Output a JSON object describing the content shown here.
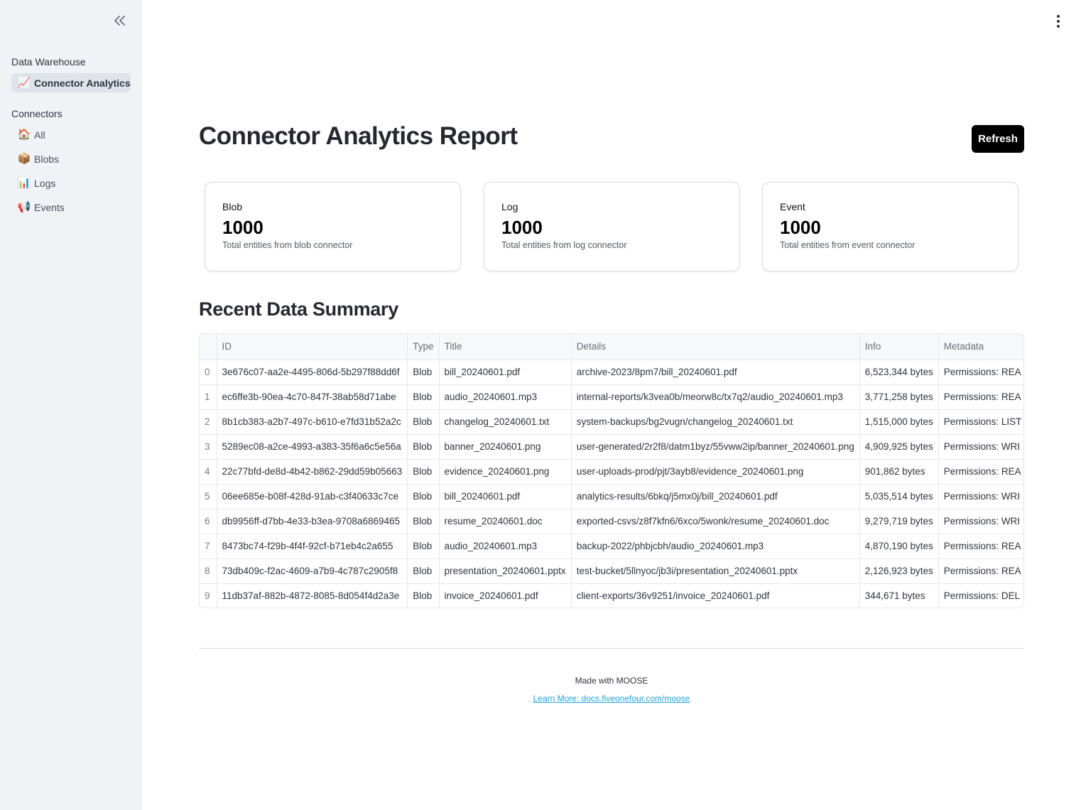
{
  "sidebar": {
    "collapse_icon": "double-chevron-left-icon",
    "section_warehouse": "Data Warehouse",
    "warehouse_items": [
      {
        "emoji": "📈",
        "label": "Connector Analytics",
        "active": true
      }
    ],
    "section_connectors": "Connectors",
    "connector_items": [
      {
        "emoji": "🏠",
        "label": "All"
      },
      {
        "emoji": "📦",
        "label": "Blobs"
      },
      {
        "emoji": "📊",
        "label": "Logs"
      },
      {
        "emoji": "📢",
        "label": "Events"
      }
    ]
  },
  "header": {
    "menu_icon": "kebab-menu-icon",
    "title": "Connector Analytics Report",
    "refresh_label": "Refresh"
  },
  "cards": [
    {
      "title": "Blob",
      "value": "1000",
      "desc": "Total entities from blob connector"
    },
    {
      "title": "Log",
      "value": "1000",
      "desc": "Total entities from log connector"
    },
    {
      "title": "Event",
      "value": "1000",
      "desc": "Total entities from event connector"
    }
  ],
  "summary": {
    "title": "Recent Data Summary",
    "columns": [
      "",
      "ID",
      "Type",
      "Title",
      "Details",
      "Info",
      "Metadata"
    ],
    "rows": [
      [
        "0",
        "3e676c07-aa2e-4495-806d-5b297f88dd6f",
        "Blob",
        "bill_20240601.pdf",
        "archive-2023/8pm7/bill_20240601.pdf",
        "6,523,344 bytes",
        "Permissions: REA"
      ],
      [
        "1",
        "ec6ffe3b-90ea-4c70-847f-38ab58d71abe",
        "Blob",
        "audio_20240601.mp3",
        "internal-reports/k3vea0b/meorw8c/tx7q2/audio_20240601.mp3",
        "3,771,258 bytes",
        "Permissions: REA"
      ],
      [
        "2",
        "8b1cb383-a2b7-497c-b610-e7fd31b52a2c",
        "Blob",
        "changelog_20240601.txt",
        "system-backups/bg2vugn/changelog_20240601.txt",
        "1,515,000 bytes",
        "Permissions: LIST"
      ],
      [
        "3",
        "5289ec08-a2ce-4993-a383-35f6a6c5e56a",
        "Blob",
        "banner_20240601.png",
        "user-generated/2r2f8/datm1byz/55vww2ip/banner_20240601.png",
        "4,909,925 bytes",
        "Permissions: WRI"
      ],
      [
        "4",
        "22c77bfd-de8d-4b42-b862-29dd59b05663",
        "Blob",
        "evidence_20240601.png",
        "user-uploads-prod/pjt/3ayb8/evidence_20240601.png",
        "901,862 bytes",
        "Permissions: REA"
      ],
      [
        "5",
        "06ee685e-b08f-428d-91ab-c3f40633c7ce",
        "Blob",
        "bill_20240601.pdf",
        "analytics-results/6bkq/j5mx0j/bill_20240601.pdf",
        "5,035,514 bytes",
        "Permissions: WRI"
      ],
      [
        "6",
        "db9956ff-d7bb-4e33-b3ea-9708a6869465",
        "Blob",
        "resume_20240601.doc",
        "exported-csvs/z8f7kfn6/6xco/5wonk/resume_20240601.doc",
        "9,279,719 bytes",
        "Permissions: WRI"
      ],
      [
        "7",
        "8473bc74-f29b-4f4f-92cf-b71eb4c2a655",
        "Blob",
        "audio_20240601.mp3",
        "backup-2022/phbjcbh/audio_20240601.mp3",
        "4,870,190 bytes",
        "Permissions: REA"
      ],
      [
        "8",
        "73db409c-f2ac-4609-a7b9-4c787c2905f8",
        "Blob",
        "presentation_20240601.pptx",
        "test-bucket/5llnyoc/jb3i/presentation_20240601.pptx",
        "2,126,923 bytes",
        "Permissions: REA"
      ],
      [
        "9",
        "11db37af-882b-4872-8085-8d054f4d2a3e",
        "Blob",
        "invoice_20240601.pdf",
        "client-exports/36v9251/invoice_20240601.pdf",
        "344,671 bytes",
        "Permissions: DEL"
      ]
    ]
  },
  "footer": {
    "made_with": "Made with MOOSE",
    "link": "Learn More: docs.fiveonefour.com/moose"
  }
}
